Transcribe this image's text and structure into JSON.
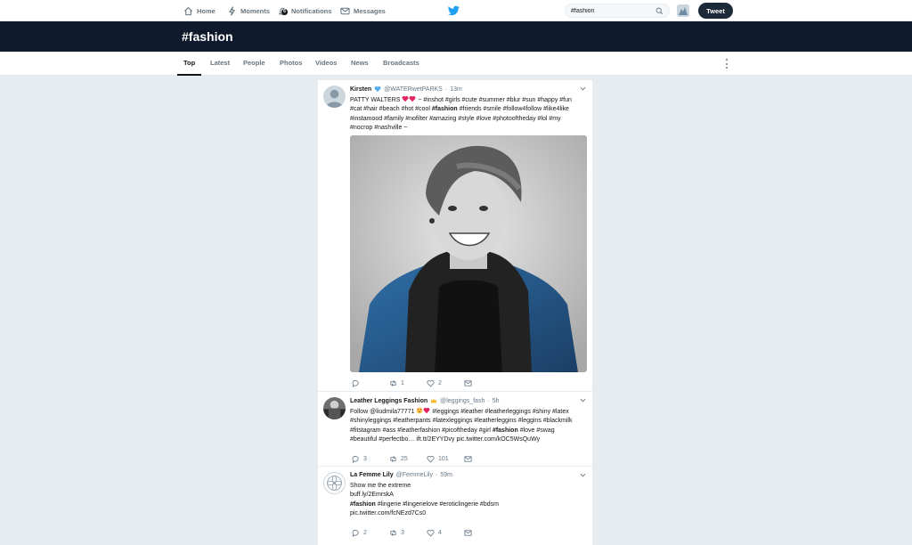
{
  "nav": {
    "home": "Home",
    "moments": "Moments",
    "notifications": "Notifications",
    "notifications_badge": "6",
    "messages": "Messages"
  },
  "search": {
    "value": "#fashion"
  },
  "tweet_button": "Tweet",
  "page_title": "#fashion",
  "tabs": [
    "Top",
    "Latest",
    "People",
    "Photos",
    "Videos",
    "News",
    "Broadcasts"
  ],
  "colors": {
    "brand": "#1da1f2",
    "band": "#0f1a2c",
    "heart": "#e0245e",
    "text_secondary": "#657786"
  },
  "tweets": [
    {
      "name": "Kirsten",
      "verified_emoji": "blue-heart",
      "handle": "@WATERwetPARKS",
      "sep": "·",
      "time": "13m",
      "text_1": "PATTY WALTERS",
      "text_2": "~ #inshot #girls #cute #summer #blur #sun #happy #fun",
      "text_3": "#cat #hair #beach #hot #cool",
      "text_bold": "#fashion",
      "text_4": "#friends #smile #follow4follow #like4like",
      "text_5": "#instamood #family #nofilter #amazing #style #love #photooftheday #lol #my",
      "text_6": "#nocrop #nashville ~",
      "replies": "",
      "retweets": "1",
      "likes": "2"
    },
    {
      "name": "Leather Leggings Fashion",
      "handle": "@leggings_fash",
      "sep": "·",
      "time": "5h",
      "text_1": "Follow @liudmila77771",
      "text_2": "#leggings #leather #leatherleggings #shiny #latex",
      "text_3": "#shinyleggings #leatherpants #latexleggings  #leatherleggins #leggins #blackmilk",
      "text_4": "#fitstagram #ass #leatherfashion #picoftheday #girl",
      "text_bold": "#fashion",
      "text_5": "#love #swag",
      "text_6": "#beautiful #perfectbo…  ift.tt/2EYYDvy pic.twitter.com/kOC5WsQuWy",
      "replies": "3",
      "retweets": "25",
      "likes": "101"
    },
    {
      "name": "La Femme Lily",
      "handle": "@FemmeLily",
      "sep": "·",
      "time": "59m",
      "text_1": "Show me the extreme",
      "text_2": "buff.ly/2EmrskA",
      "text_bold": "#fashion",
      "text_3": "#lingerie #lingerielove #eroticlingerie #bdsm",
      "text_4": "pic.twitter.com/fcNEzd7Cs0",
      "replies": "2",
      "retweets": "3",
      "likes": "4"
    }
  ]
}
